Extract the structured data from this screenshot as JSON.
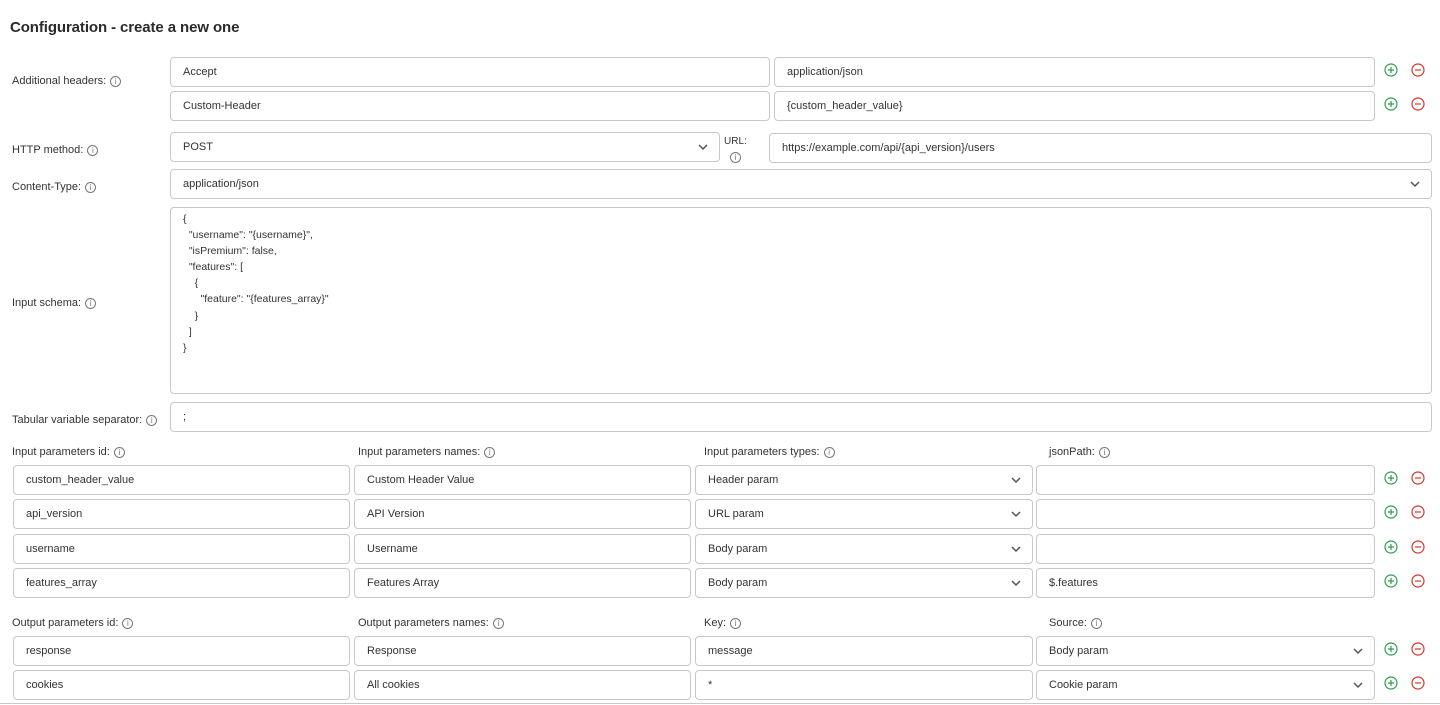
{
  "page": {
    "title": "Configuration - create a new one"
  },
  "labels": {
    "additional_headers": "Additional headers:",
    "http_method": "HTTP method:",
    "url": "URL:",
    "content_type": "Content-Type:",
    "input_schema": "Input schema:",
    "tabular_separator": "Tabular variable separator:",
    "input_params_id": "Input parameters id:",
    "input_params_names": "Input parameters names:",
    "input_params_types": "Input parameters types:",
    "json_path": "jsonPath:",
    "output_params_id": "Output parameters id:",
    "output_params_names": "Output parameters names:",
    "key": "Key:",
    "source": "Source:"
  },
  "headers": [
    {
      "name": "Accept",
      "value": "application/json"
    },
    {
      "name": "Custom-Header",
      "value": "{custom_header_value}"
    }
  ],
  "http_method": "POST",
  "url": "https://example.com/api/{api_version}/users",
  "content_type": "application/json",
  "input_schema": "{\n  \"username\": \"{username}\",\n  \"isPremium\": false,\n  \"features\": [\n    {\n      \"feature\": \"{features_array}\"\n    }\n  ]\n}",
  "tabular_separator": ";",
  "input_params": [
    {
      "id": "custom_header_value",
      "name": "Custom Header Value",
      "type": "Header param",
      "json_path": ""
    },
    {
      "id": "api_version",
      "name": "API Version",
      "type": "URL param",
      "json_path": ""
    },
    {
      "id": "username",
      "name": "Username",
      "type": "Body param",
      "json_path": ""
    },
    {
      "id": "features_array",
      "name": "Features Array",
      "type": "Body param",
      "json_path": "$.features"
    }
  ],
  "output_params": [
    {
      "id": "response",
      "name": "Response",
      "key": "message",
      "source": "Body param"
    },
    {
      "id": "cookies",
      "name": "All cookies",
      "key": "*",
      "source": "Cookie param"
    }
  ],
  "icons": {
    "info": "info-icon",
    "add": "plus-circle-icon",
    "remove": "minus-circle-icon",
    "dropdown": "chevron-down-icon"
  },
  "colors": {
    "add": "#2e9e4f",
    "remove": "#d9342b",
    "border": "#c8c8c8",
    "text": "#333333"
  }
}
